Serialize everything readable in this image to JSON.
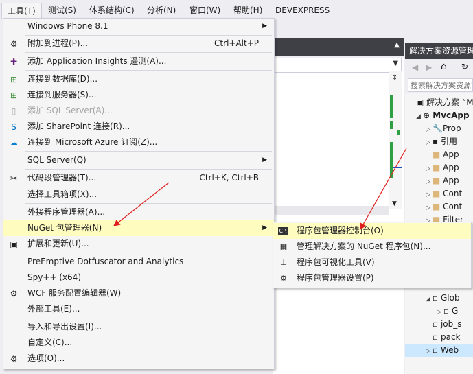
{
  "menubar": {
    "items": [
      "工具(T)",
      "测试(S)",
      "体系结构(C)",
      "分析(N)",
      "窗口(W)",
      "帮助(H)",
      "DEVEXPRESS"
    ]
  },
  "tools_menu": {
    "windows_phone": "Windows Phone 8.1",
    "attach_process": "附加到进程(P)...",
    "attach_process_shortcut": "Ctrl+Alt+P",
    "add_app_insights": "添加 Application Insights 遥测(A)...",
    "connect_db": "连接到数据库(D)...",
    "connect_server": "连接到服务器(S)...",
    "add_sql_server": "添加 SQL Server(A)...",
    "add_sharepoint": "添加 SharePoint 连接(R)...",
    "connect_azure": "连接到 Microsoft Azure 订阅(Z)...",
    "sql_server": "SQL Server(Q)",
    "snippets": "代码段管理器(T)...",
    "snippets_shortcut": "Ctrl+K, Ctrl+B",
    "choose_toolbox": "选择工具箱项(X)...",
    "extensions_manager": "外接程序管理器(A)...",
    "nuget": "NuGet 包管理器(N)",
    "extensions_updates": "扩展和更新(U)...",
    "preemptive": "PreEmptive Dotfuscator and Analytics",
    "spy": "Spy++ (x64)",
    "wcf": "WCF 服务配置编辑器(W)",
    "external_tools": "外部工具(E)...",
    "import_export": "导入和导出设置(I)...",
    "customize": "自定义(C)...",
    "options": "选项(O)..."
  },
  "nuget_submenu": {
    "console": "程序包管理器控制台(O)",
    "manage_solution": "管理解决方案的 NuGet 程序包(N)...",
    "visualizer": "程序包可视化工具(V)",
    "settings": "程序包管理器设置(P)"
  },
  "solution_explorer": {
    "title": "解决方案资源管理器",
    "search_placeholder": "搜索解决方案资源管理器",
    "tree": [
      "解决方案 “M",
      "MvcApp",
      "Prop",
      "引用",
      "App_",
      "App_",
      "App_",
      "Cont",
      "Cont",
      "Filter",
      "Glob",
      "G",
      "job_s",
      "pack",
      "Web"
    ]
  }
}
